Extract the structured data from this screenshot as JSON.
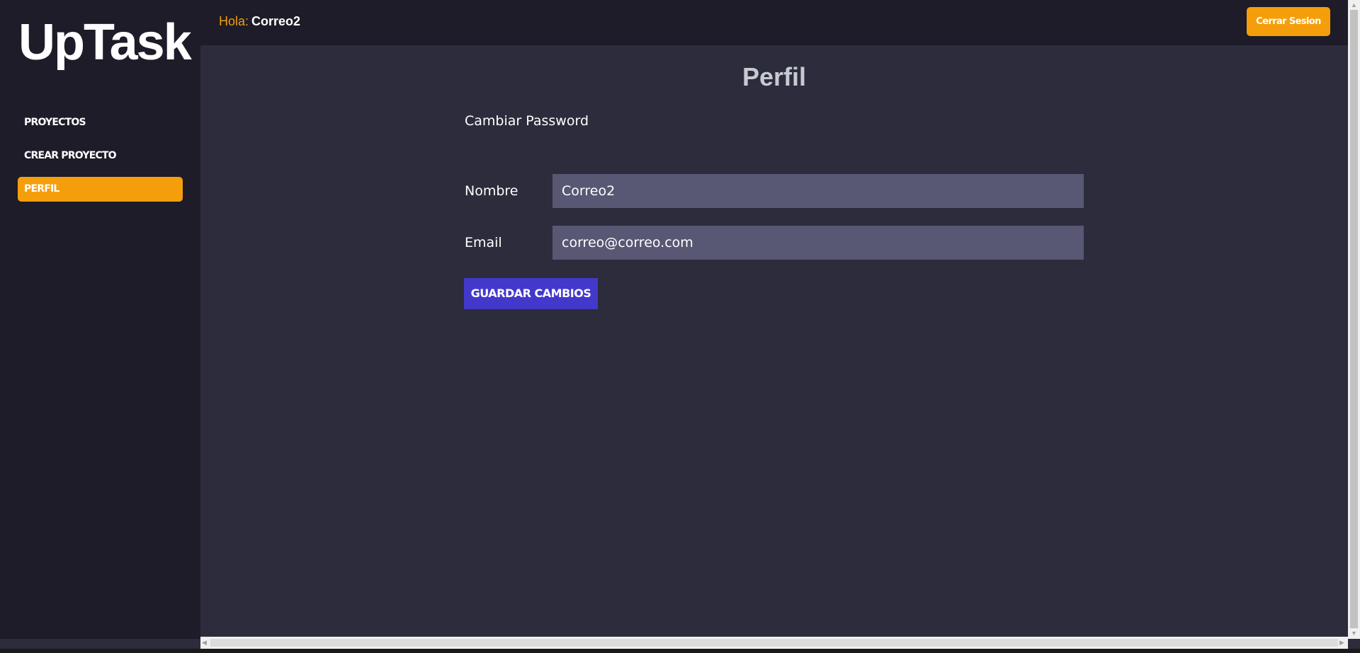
{
  "app": {
    "logo": "UpTask"
  },
  "sidebar": {
    "items": [
      {
        "label": "PROYECTOS",
        "active": false
      },
      {
        "label": "CREAR PROYECTO",
        "active": false
      },
      {
        "label": "PERFIL",
        "active": true
      }
    ]
  },
  "header": {
    "greeting_label": "Hola:",
    "username": "Correo2",
    "logout_label": "Cerrar Sesion"
  },
  "main": {
    "title": "Perfil",
    "change_password_link": "Cambiar Password",
    "form": {
      "name_label": "Nombre",
      "name_value": "Correo2",
      "email_label": "Email",
      "email_value": "correo@correo.com",
      "submit_label": "GUARDAR CAMBIOS"
    }
  },
  "colors": {
    "accent": "#f59e0b",
    "primary_button": "#4338ca",
    "sidebar_bg": "#1d1c28",
    "main_bg": "#2d2c3c",
    "input_bg": "#585774",
    "title_color": "#c5cad3"
  }
}
